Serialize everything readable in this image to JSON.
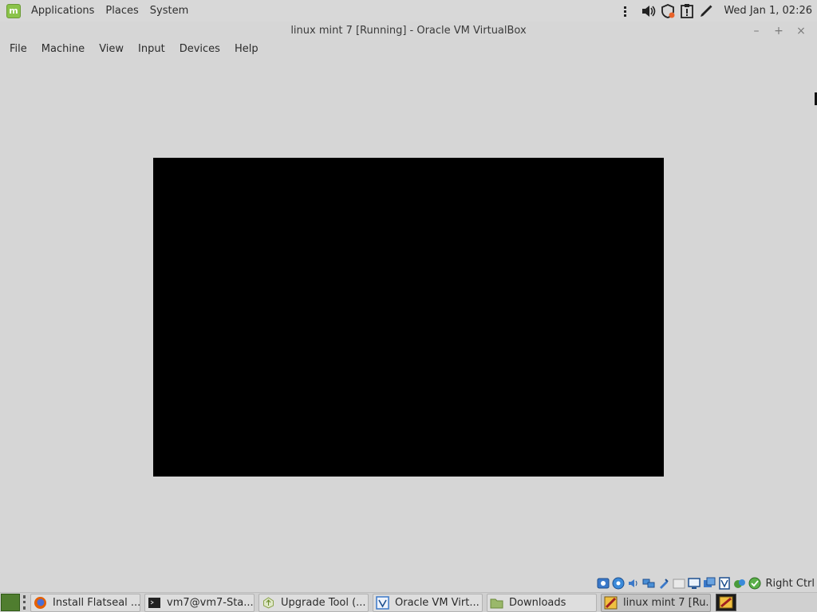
{
  "top_panel": {
    "menus": [
      "Applications",
      "Places",
      "System"
    ],
    "clock": "Wed Jan  1, 02:26",
    "tray_icons": [
      "network-icon",
      "volume-icon",
      "security-shield-icon",
      "update-manager-icon",
      "pen-icon"
    ]
  },
  "window": {
    "title": "linux mint 7 [Running] - Oracle VM VirtualBox",
    "controls": {
      "minimize": "–",
      "maximize": "+",
      "close": "×"
    }
  },
  "menubar": {
    "items": [
      "File",
      "Machine",
      "View",
      "Input",
      "Devices",
      "Help"
    ]
  },
  "statusbar": {
    "host_key": "Right Ctrl",
    "icons": [
      "hard-disk-icon",
      "optical-disk-icon",
      "audio-icon",
      "network-adapter-icon",
      "usb-icon",
      "shared-folder-icon",
      "display-icon",
      "recording-icon",
      "cpu-icon",
      "virtualization-icon",
      "mouse-integration-icon",
      "keyboard-capture-icon"
    ]
  },
  "taskbar": {
    "tasks": [
      {
        "label": "Install Flatseal ...",
        "icon": "firefox-icon",
        "active": false
      },
      {
        "label": "vm7@vm7-Sta...",
        "icon": "terminal-icon",
        "active": false
      },
      {
        "label": "Upgrade Tool (...",
        "icon": "upgrade-tool-icon",
        "active": false
      },
      {
        "label": "Oracle VM Virt...",
        "icon": "virtualbox-icon",
        "active": false
      },
      {
        "label": "Downloads",
        "icon": "folder-icon",
        "active": false
      },
      {
        "label": "linux mint 7 [Ru...",
        "icon": "vm-icon",
        "active": true
      }
    ]
  },
  "colors": {
    "panel_bg": "#d8d8d8",
    "window_bg": "#d6d6d6",
    "vm_screen": "#000000",
    "mint_green": "#8bc34a"
  }
}
